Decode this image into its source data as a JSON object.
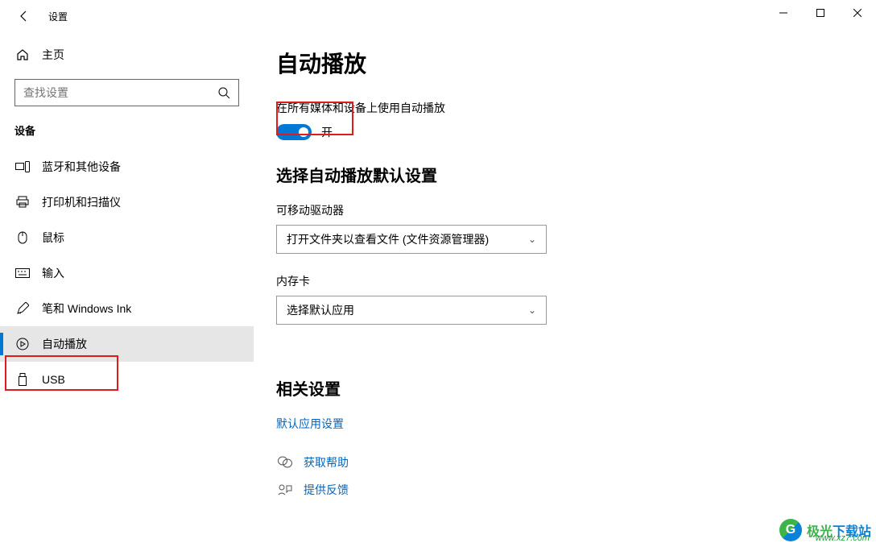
{
  "window": {
    "title": "设置"
  },
  "sidebar": {
    "home_label": "主页",
    "search_placeholder": "查找设置",
    "section_label": "设备",
    "items": [
      {
        "label": "蓝牙和其他设备"
      },
      {
        "label": "打印机和扫描仪"
      },
      {
        "label": "鼠标"
      },
      {
        "label": "输入"
      },
      {
        "label": "笔和 Windows Ink"
      },
      {
        "label": "自动播放"
      },
      {
        "label": "USB"
      }
    ]
  },
  "content": {
    "page_title": "自动播放",
    "toggle_description": "在所有媒体和设备上使用自动播放",
    "toggle_state_label": "开",
    "defaults_section_title": "选择自动播放默认设置",
    "removable_label": "可移动驱动器",
    "removable_value": "打开文件夹以查看文件 (文件资源管理器)",
    "memorycard_label": "内存卡",
    "memorycard_value": "选择默认应用",
    "related_section_title": "相关设置",
    "related_link": "默认应用设置",
    "help_link": "获取帮助",
    "feedback_link": "提供反馈"
  },
  "watermark": {
    "brand1": "极光",
    "brand2": "下载站",
    "url": "www.xz7.com"
  }
}
